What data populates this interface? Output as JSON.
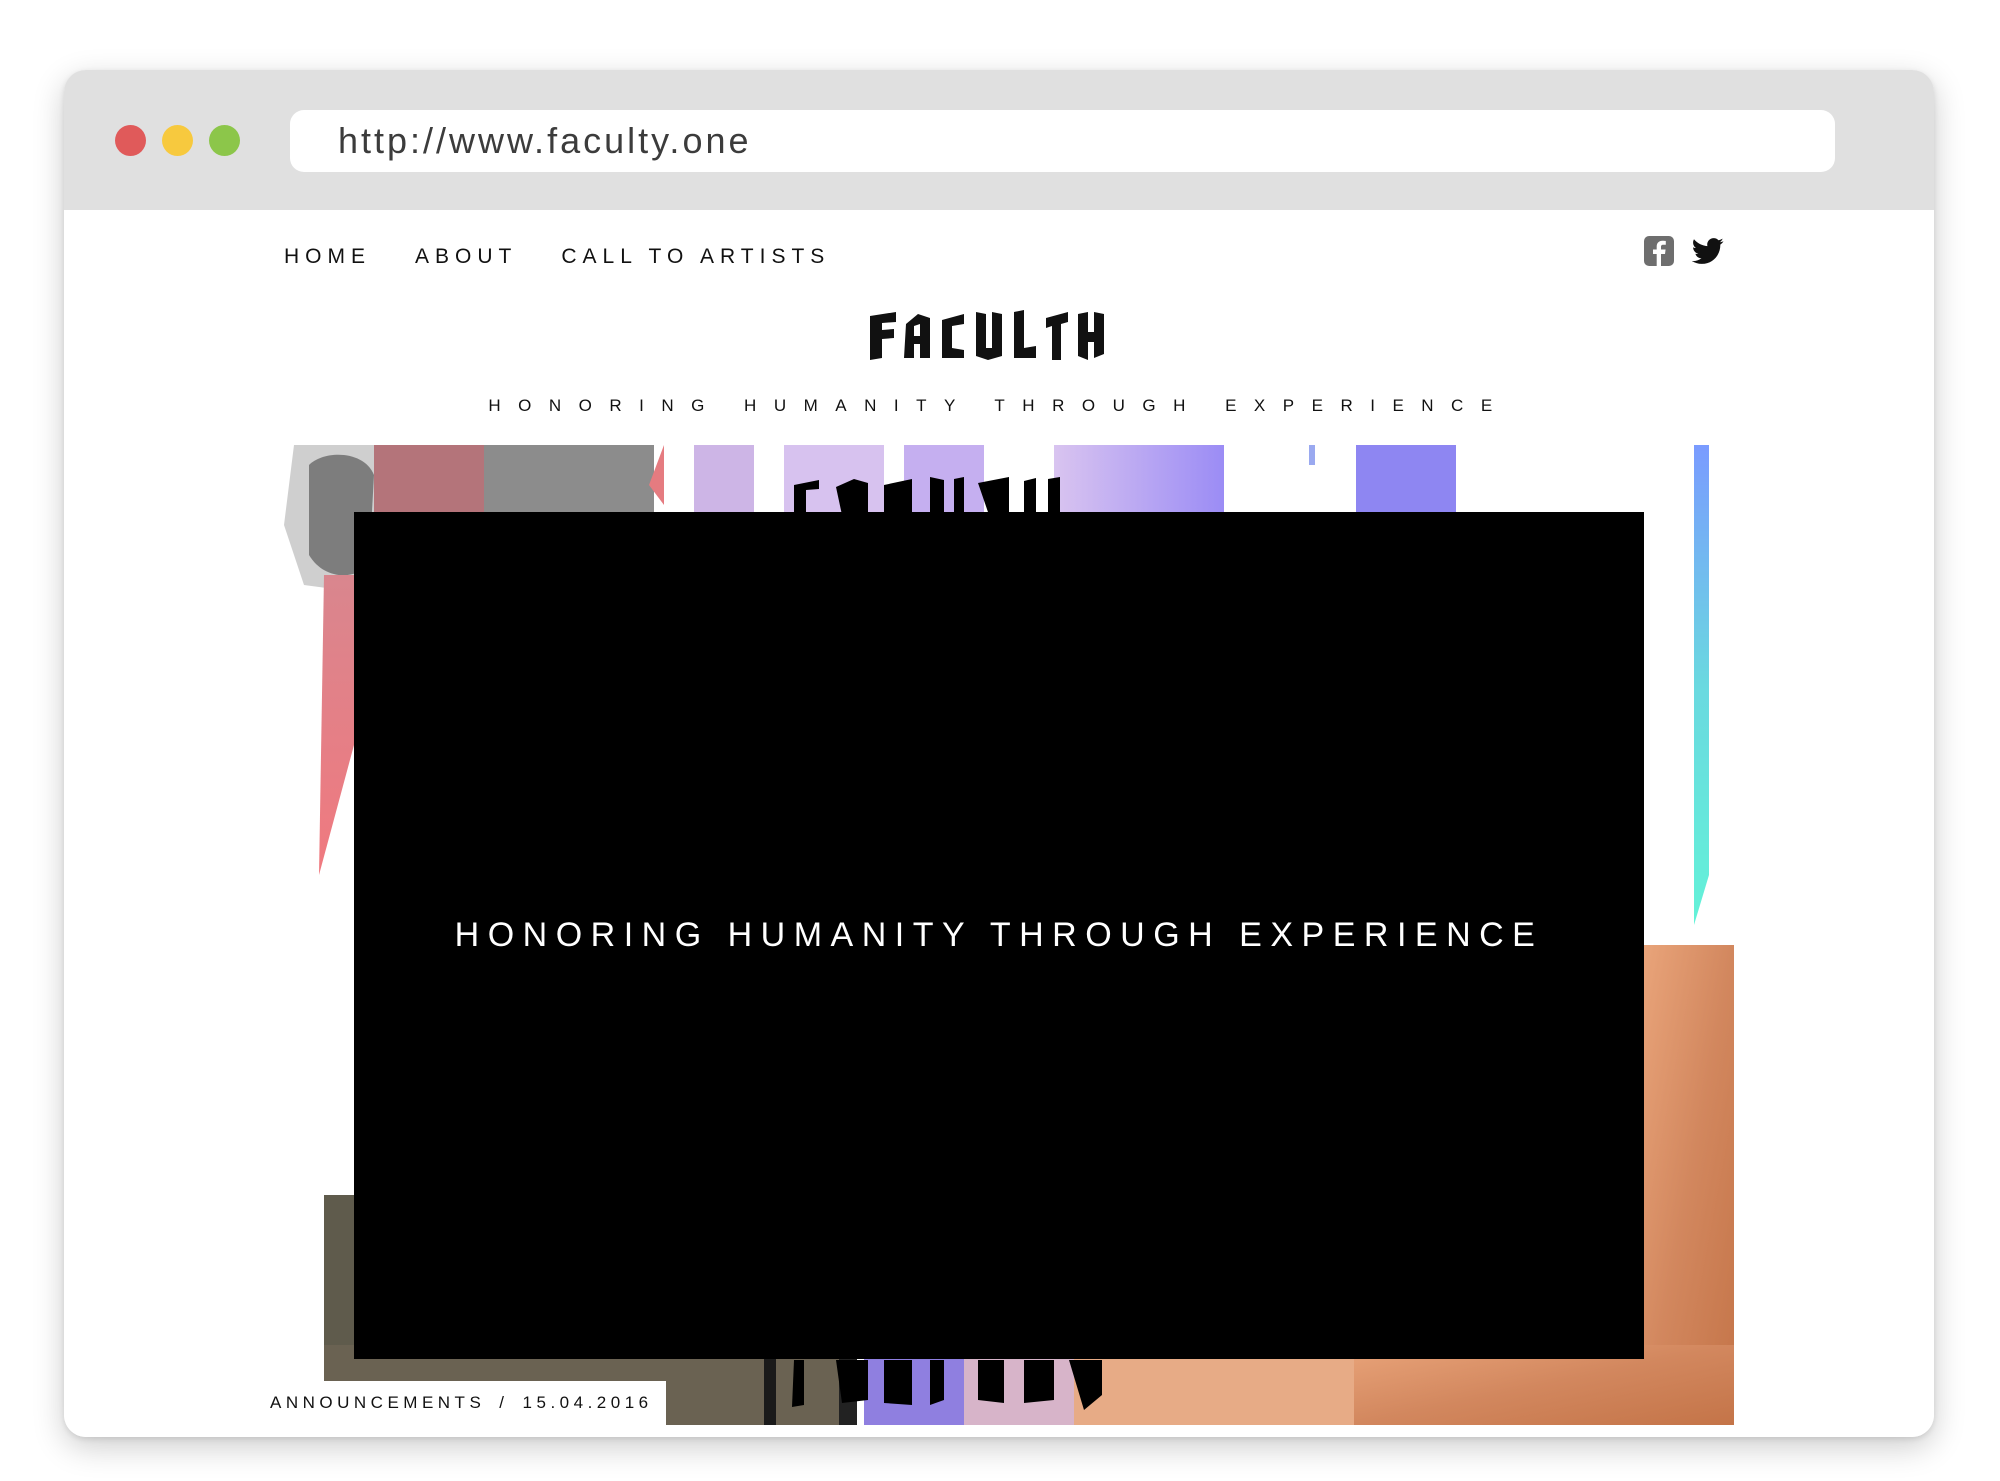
{
  "window": {
    "traffic_lights": {
      "close": "#e05a5a",
      "minimize": "#f7c93e",
      "zoom": "#8cc64a"
    },
    "address_bar": {
      "url": "http://www.faculty.one"
    }
  },
  "nav": {
    "items": [
      {
        "label": "HOME"
      },
      {
        "label": "ABOUT"
      },
      {
        "label": "CALL TO ARTISTS"
      }
    ]
  },
  "social": {
    "icons": [
      "facebook-icon",
      "twitter-icon"
    ]
  },
  "brand": {
    "logo": "FACULTY",
    "tagline": "HONORING HUMANITY THROUGH EXPERIENCE"
  },
  "hero": {
    "video_text": "HONORING HUMANITY THROUGH EXPERIENCE",
    "caption": {
      "category": "ANNOUNCEMENTS",
      "separator": "/",
      "date": "15.04.2016"
    }
  }
}
